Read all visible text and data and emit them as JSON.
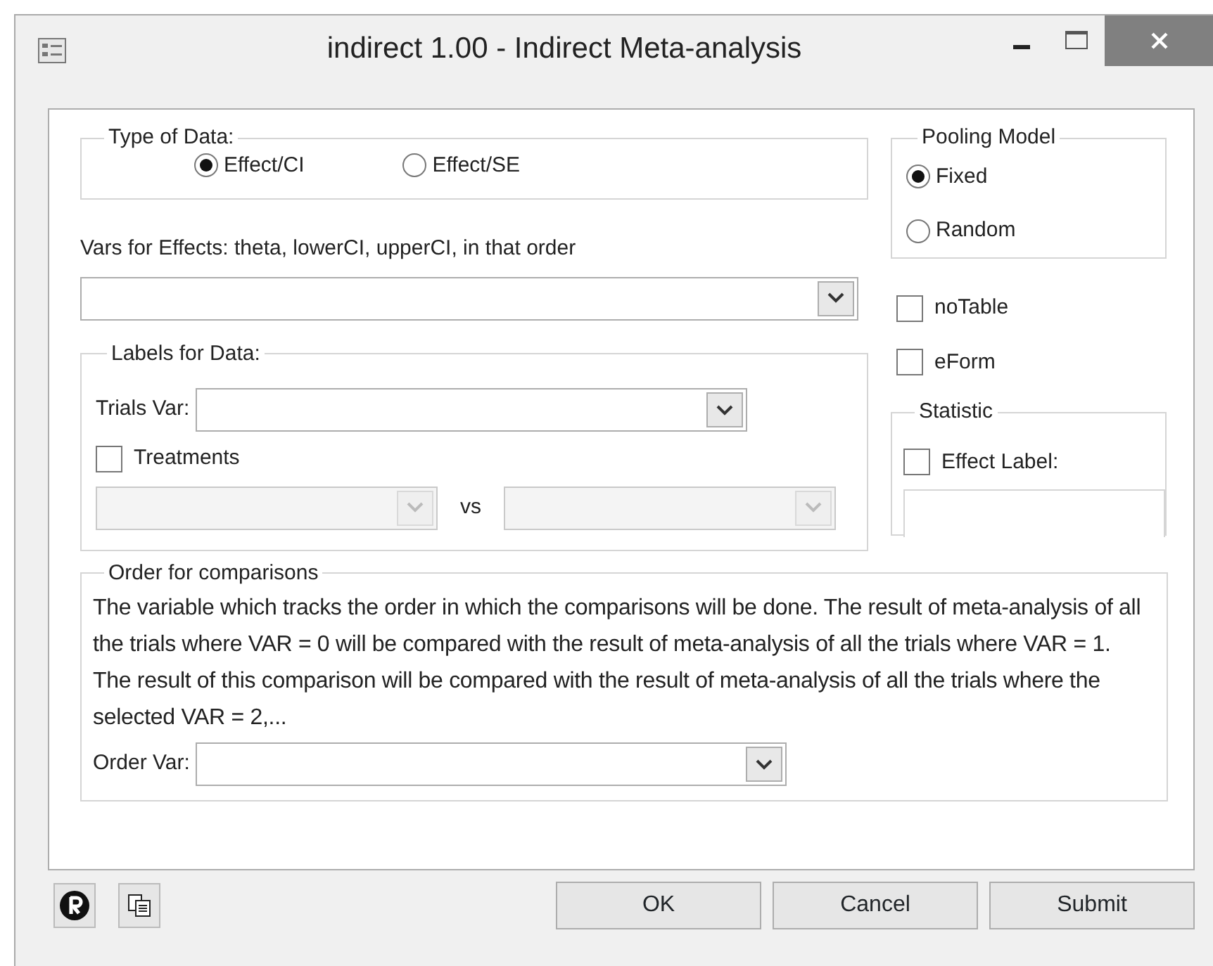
{
  "window": {
    "title": "indirect 1.00 - Indirect Meta-analysis"
  },
  "type_of_data": {
    "legend": "Type of Data:",
    "options": [
      {
        "label": "Effect/CI",
        "selected": true
      },
      {
        "label": "Effect/SE",
        "selected": false
      }
    ]
  },
  "vars_for_effects": {
    "label": "Vars for Effects: theta, lowerCI, upperCI, in that order"
  },
  "labels_for_data": {
    "legend": "Labels for Data:",
    "trials_var": {
      "label": "Trials Var:"
    },
    "treatments": {
      "label": "Treatments",
      "checked": false
    },
    "selectors": [
      {
        "disabled": true
      },
      {
        "disabled": true
      }
    ],
    "vs": "vs"
  },
  "order": {
    "legend": "Order for comparisons",
    "description": "The variable which tracks the order in which the comparisons will be done. The result of meta-analysis of all the trials where VAR = 0 will be compared with the result of meta-analysis of all the trials where VAR = 1. The result of this comparison will be compared with the result of meta-analysis of all the trials where the selected VAR = 2,...",
    "order_var": {
      "label": "Order Var:"
    }
  },
  "pooling_model": {
    "legend": "Pooling Model",
    "options": [
      {
        "label": "Fixed",
        "selected": true
      },
      {
        "label": "Random",
        "selected": false
      }
    ]
  },
  "options": [
    {
      "label": "noTable",
      "checked": false
    },
    {
      "label": "eForm",
      "checked": false
    }
  ],
  "statistic": {
    "legend": "Statistic",
    "effect_label": {
      "label": "Effect Label:",
      "checked": false
    }
  },
  "buttons": [
    "OK",
    "Cancel",
    "Submit"
  ]
}
